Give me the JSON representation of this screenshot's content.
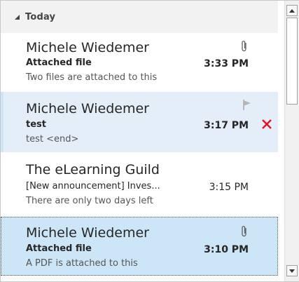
{
  "group": {
    "label": "Today"
  },
  "messages": [
    {
      "sender": "Michele Wiedemer",
      "subject": "Attached file",
      "preview": "Two files are attached to this",
      "time": "3:33 PM",
      "icon": "paperclip-icon"
    },
    {
      "sender": "Michele Wiedemer",
      "subject": "test",
      "preview": "test <end>",
      "time": "3:17 PM",
      "icons": [
        "flag-icon",
        "delete-icon"
      ],
      "delete_color": "#e81123"
    },
    {
      "sender": "The eLearning Guild",
      "subject": "[New announcement] Inves...",
      "preview": "There are only two days left",
      "time": "3:15 PM"
    },
    {
      "sender": "Michele Wiedemer",
      "subject": "Attached file",
      "preview": "A PDF is attached to this",
      "time": "3:10 PM",
      "icon": "paperclip-icon"
    }
  ],
  "colors": {
    "hover_bg": "#e3eef9",
    "selected_bg": "#cde6f7",
    "header_bg": "#f2f2f2"
  }
}
